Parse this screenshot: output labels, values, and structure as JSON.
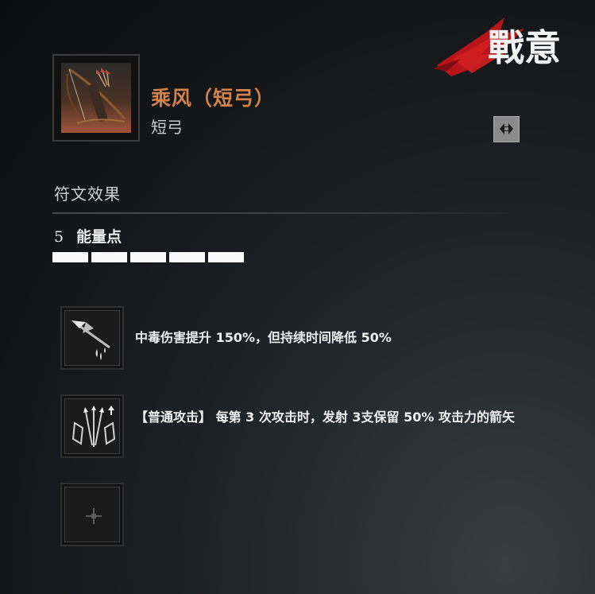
{
  "logo": {
    "text": "戰意",
    "icon": "zhanyi-logo"
  },
  "item": {
    "name": "乘风（短弓）",
    "type": "短弓",
    "icon": "bow-and-quiver-icon",
    "swap_icon": "swap-arrows-icon"
  },
  "runes": {
    "section_title": "符文效果",
    "energy_value": "5",
    "energy_label": "能量点",
    "energy_pips": 5,
    "slots": [
      {
        "icon": "poison-arrowhead-icon",
        "text": "中毒伤害提升 150%，但持续时间降低 50%"
      },
      {
        "icon": "multi-arrow-icon",
        "text": "【普通攻击】 每第 3 次攻击时，发射 3支保留 50% 攻击力的箭矢"
      },
      {
        "icon": "empty-slot-plus-icon",
        "text": ""
      }
    ]
  },
  "colors": {
    "item_name": "#d2824a",
    "logo_red": "#b8151b"
  }
}
